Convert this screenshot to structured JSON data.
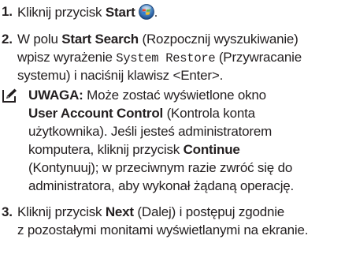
{
  "step1": {
    "number": "1.",
    "text_before": "Kliknij przycisk ",
    "bold": "Start",
    "icon": "windows-start-orb-icon",
    "after_icon": "."
  },
  "step2": {
    "number": "2.",
    "line1_pre": "W polu ",
    "line1_bold": "Start Search",
    "line1_post": " (Rozpocznij wyszukiwanie)",
    "line2_pre": "wpisz wyrażenie ",
    "line2_mono": "System Restore",
    "line2_post": " (Przywracanie",
    "line3": "systemu) i naciśnij klawisz <Enter>."
  },
  "note": {
    "icon": "pencil-note-icon",
    "line1_bold": "UWAGA:",
    "line1_post": " Może zostać wyświetlone okno",
    "line2_bold": "User Account Control",
    "line2_post": " (Kontrola konta",
    "line3": "użytkownika). Jeśli jesteś administratorem",
    "line4_pre": "komputera, kliknij przycisk ",
    "line4_bold": "Continue",
    "line5": "(Kontynuuj); w przeciwnym razie zwróć się do",
    "line6": "administratora, aby wykonał żądaną operację."
  },
  "step3": {
    "number": "3.",
    "line1_pre": "Kliknij przycisk ",
    "line1_bold": "Next",
    "line1_post": " (Dalej) i postępuj zgodnie",
    "line2": "z pozostałymi monitami wyświetlanymi na ekranie."
  }
}
